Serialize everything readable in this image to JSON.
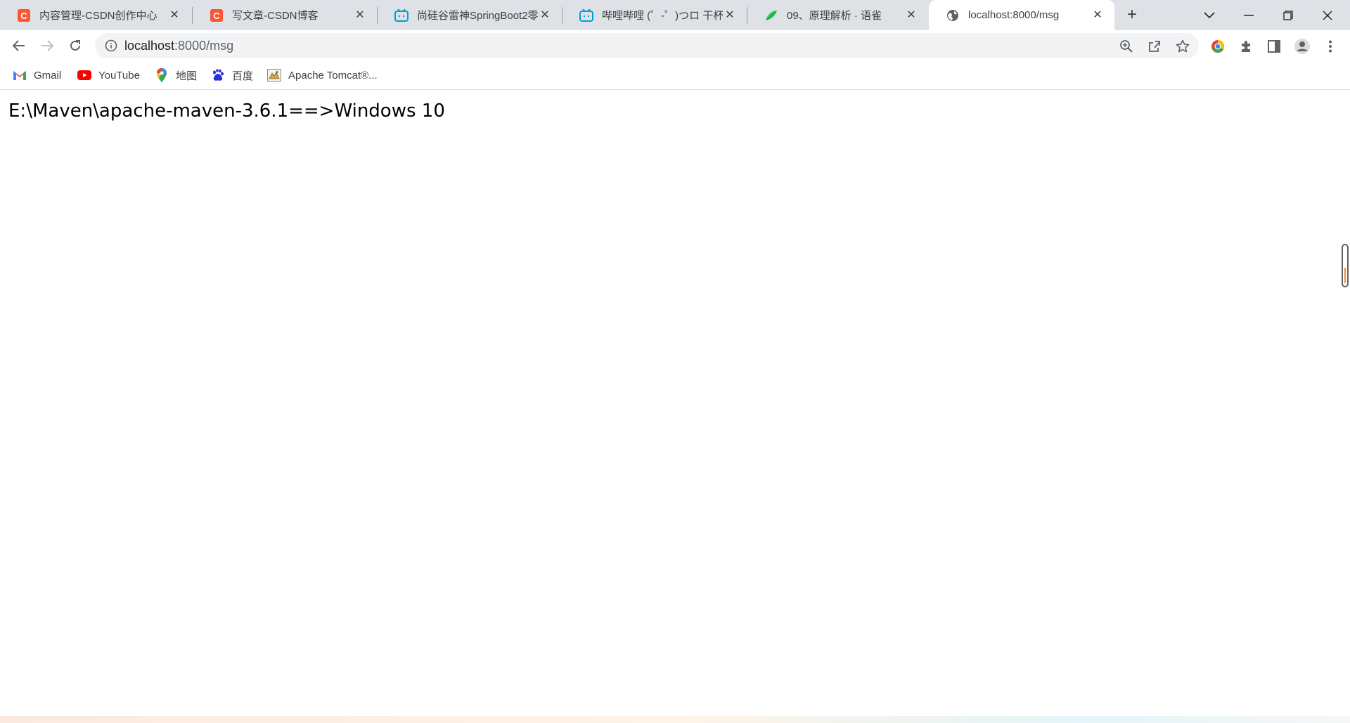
{
  "tabs": [
    {
      "title": "内容管理-CSDN创作中心",
      "icon": "csdn-icon"
    },
    {
      "title": "写文章-CSDN博客",
      "icon": "csdn-icon"
    },
    {
      "title": "尚硅谷雷神SpringBoot2零",
      "icon": "bilibili-icon"
    },
    {
      "title": "哔哩哔哩 (゜-゜)つロ 干杯~",
      "icon": "bilibili-icon"
    },
    {
      "title": "09、原理解析 · 语雀",
      "icon": "yuque-icon"
    },
    {
      "title": "localhost:8000/msg",
      "icon": "globe-icon",
      "active": true
    }
  ],
  "omnibox": {
    "host": "localhost",
    "path": ":8000/msg"
  },
  "bookmarks": [
    {
      "label": "Gmail",
      "icon": "gmail-icon"
    },
    {
      "label": "YouTube",
      "icon": "youtube-icon"
    },
    {
      "label": "地图",
      "icon": "maps-icon"
    },
    {
      "label": "百度",
      "icon": "baidu-icon"
    },
    {
      "label": "Apache Tomcat®...",
      "icon": "tomcat-icon"
    }
  ],
  "page": {
    "message": "E:\\Maven\\apache-maven-3.6.1==>Windows 10"
  },
  "colors": {
    "tabstrip": "#dee1e6",
    "csdn": "#fc5531",
    "bilibili": "#00a1d6",
    "yuque": "#31cc5a",
    "youtube": "#ff0000"
  }
}
